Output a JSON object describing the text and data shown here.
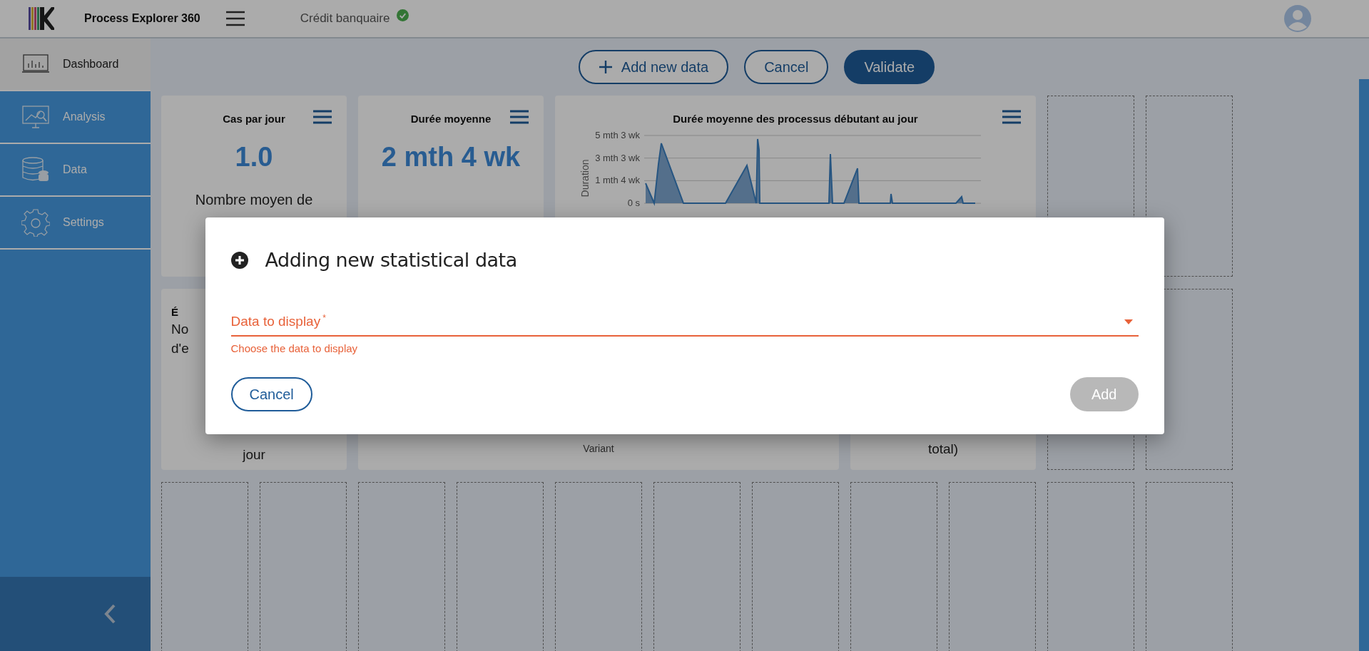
{
  "app": {
    "title": "Process Explorer 360",
    "dataset": "Crédit banquaire",
    "dataset_verified": true
  },
  "sidebar": {
    "items": [
      {
        "label": "Dashboard",
        "kind": "dashboard",
        "selected": true
      },
      {
        "label": "Analysis",
        "kind": "analysis",
        "selected": false
      },
      {
        "label": "Data",
        "kind": "data",
        "selected": false
      },
      {
        "label": "Settings",
        "kind": "settings",
        "selected": false
      }
    ]
  },
  "toolbar": {
    "buttons": [
      {
        "label": "Add new data",
        "kind": "add"
      },
      {
        "label": "Cancel",
        "kind": "outline"
      },
      {
        "label": "Validate",
        "kind": "primary"
      }
    ]
  },
  "cards": [
    {
      "kind": "kpi",
      "title": "Cas par jour",
      "value": "1.0",
      "lines": [
        "Nombre moyen de"
      ]
    },
    {
      "kind": "kpi",
      "title": "Durée moyenne",
      "value": "2 mth 4 wk"
    },
    {
      "kind": "chart",
      "title": "Durée moyenne des processus débutant au jour",
      "y_label": "Duration",
      "y_ticks": [
        "5 mth 3 wk",
        "3 mth 3 wk",
        "1 mth 4 wk",
        "0 s"
      ]
    },
    {
      "kind": "peek",
      "title": "É",
      "lines": [
        "No",
        "d'e"
      ],
      "footer": "jour"
    },
    {
      "kind": "caption",
      "footer": "Variant"
    },
    {
      "kind": "text",
      "footer": "total)"
    }
  ],
  "dialog": {
    "title": "Adding new statistical data",
    "field": {
      "label": "Data to display",
      "required_mark": "*",
      "error": true,
      "helper": "Choose the data to display"
    },
    "cancel": "Cancel",
    "submit": {
      "label": "Add",
      "disabled": true
    }
  }
}
